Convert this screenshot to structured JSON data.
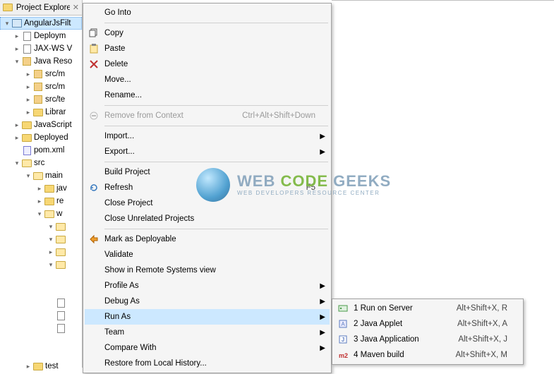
{
  "panel": {
    "title": "Project Explorer"
  },
  "tree": {
    "project": "AngularJsFilt",
    "nodes": [
      {
        "label": "Deploym",
        "depth": 1,
        "exp": "r",
        "icon": "file"
      },
      {
        "label": "JAX-WS V",
        "depth": 1,
        "exp": "r",
        "icon": "file"
      },
      {
        "label": "Java Reso",
        "depth": 1,
        "exp": "d",
        "icon": "pkg"
      },
      {
        "label": "src/m",
        "depth": 2,
        "exp": "r",
        "icon": "pkg"
      },
      {
        "label": "src/m",
        "depth": 2,
        "exp": "r",
        "icon": "pkg"
      },
      {
        "label": "src/te",
        "depth": 2,
        "exp": "r",
        "icon": "pkg"
      },
      {
        "label": "Librar",
        "depth": 2,
        "exp": "r",
        "icon": "folder"
      },
      {
        "label": "JavaScript",
        "depth": 1,
        "exp": "r",
        "icon": "folder"
      },
      {
        "label": "Deployed",
        "depth": 1,
        "exp": "r",
        "icon": "folder"
      },
      {
        "label": "pom.xml",
        "depth": 1,
        "exp": "",
        "icon": "xml"
      },
      {
        "label": "src",
        "depth": 1,
        "exp": "d",
        "icon": "folder-open"
      },
      {
        "label": "main",
        "depth": 2,
        "exp": "d",
        "icon": "folder-open"
      },
      {
        "label": "jav",
        "depth": 3,
        "exp": "r",
        "icon": "folder"
      },
      {
        "label": "re",
        "depth": 3,
        "exp": "r",
        "icon": "folder"
      },
      {
        "label": "w",
        "depth": 3,
        "exp": "d",
        "icon": "folder-open"
      },
      {
        "label": "",
        "depth": 4,
        "exp": "d",
        "icon": "folder-open"
      },
      {
        "label": "",
        "depth": 4,
        "exp": "d",
        "icon": "folder-open"
      },
      {
        "label": "",
        "depth": 4,
        "exp": "r",
        "icon": "folder-open"
      },
      {
        "label": "",
        "depth": 4,
        "exp": "d",
        "icon": "folder-open"
      },
      {
        "label": "",
        "depth": 4,
        "exp": "",
        "icon": ""
      },
      {
        "label": "",
        "depth": 4,
        "exp": "",
        "icon": ""
      },
      {
        "label": "",
        "depth": 4,
        "exp": "",
        "icon": "file"
      },
      {
        "label": "",
        "depth": 4,
        "exp": "",
        "icon": "file"
      },
      {
        "label": "",
        "depth": 4,
        "exp": "",
        "icon": "file"
      },
      {
        "label": "",
        "depth": 4,
        "exp": "",
        "icon": ""
      },
      {
        "label": "",
        "depth": 4,
        "exp": "",
        "icon": ""
      },
      {
        "label": "test",
        "depth": 2,
        "exp": "r",
        "icon": "folder"
      }
    ]
  },
  "menu": {
    "groups": [
      [
        {
          "label": "Go Into",
          "icon": ""
        }
      ],
      [
        {
          "label": "Copy",
          "icon": "copy"
        },
        {
          "label": "Paste",
          "icon": "paste"
        },
        {
          "label": "Delete",
          "icon": "delete"
        },
        {
          "label": "Move...",
          "icon": ""
        },
        {
          "label": "Rename...",
          "icon": ""
        }
      ],
      [
        {
          "label": "Remove from Context",
          "icon": "remove",
          "disabled": true,
          "accel": "Ctrl+Alt+Shift+Down"
        }
      ],
      [
        {
          "label": "Import...",
          "icon": "",
          "sub": true
        },
        {
          "label": "Export...",
          "icon": "",
          "sub": true
        }
      ],
      [
        {
          "label": "Build Project",
          "icon": ""
        },
        {
          "label": "Refresh",
          "icon": "refresh",
          "accel": "F5"
        },
        {
          "label": "Close Project",
          "icon": ""
        },
        {
          "label": "Close Unrelated Projects",
          "icon": ""
        }
      ],
      [
        {
          "label": "Mark as Deployable",
          "icon": "deploy"
        },
        {
          "label": "Validate",
          "icon": ""
        },
        {
          "label": "Show in Remote Systems view",
          "icon": ""
        },
        {
          "label": "Profile As",
          "icon": "",
          "sub": true
        },
        {
          "label": "Debug As",
          "icon": "",
          "sub": true
        },
        {
          "label": "Run As",
          "icon": "",
          "sub": true,
          "highlight": true
        },
        {
          "label": "Team",
          "icon": "",
          "sub": true
        },
        {
          "label": "Compare With",
          "icon": "",
          "sub": true
        },
        {
          "label": "Restore from Local History...",
          "icon": ""
        }
      ]
    ]
  },
  "submenu": {
    "items": [
      {
        "label": "1 Run on Server",
        "accel": "Alt+Shift+X, R",
        "icon": "server"
      },
      {
        "label": "2 Java Applet",
        "accel": "Alt+Shift+X, A",
        "icon": "applet"
      },
      {
        "label": "3 Java Application",
        "accel": "Alt+Shift+X, J",
        "icon": "java"
      },
      {
        "label": "4 Maven build",
        "accel": "Alt+Shift+X, M",
        "icon": "m2"
      }
    ]
  },
  "watermark": {
    "top_web": "WEB",
    "top_code": "CODE",
    "top_geeks": "GEEKS",
    "sub": "WEB DEVELOPERS RESOURCE CENTER"
  }
}
